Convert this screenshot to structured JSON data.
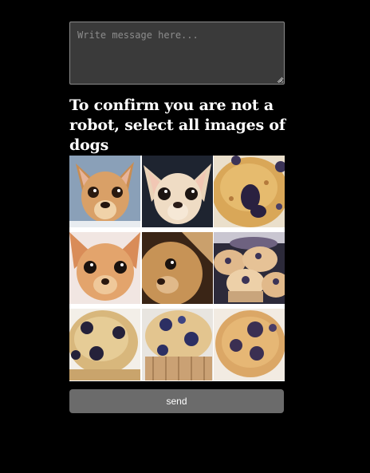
{
  "message": {
    "placeholder": "Write message here..."
  },
  "captcha": {
    "prompt": "To confirm you are not a robot, select all images of dogs",
    "tiles": [
      {
        "subject": "chihuahua-icon"
      },
      {
        "subject": "chihuahua-icon"
      },
      {
        "subject": "blueberry-muffin-icon"
      },
      {
        "subject": "chihuahua-icon"
      },
      {
        "subject": "chihuahua-icon"
      },
      {
        "subject": "blueberry-muffin-icon"
      },
      {
        "subject": "blueberry-muffin-icon"
      },
      {
        "subject": "blueberry-muffin-icon"
      },
      {
        "subject": "blueberry-muffin-icon"
      }
    ]
  },
  "actions": {
    "send_label": "send"
  },
  "colors": {
    "page_background": "#000000",
    "textarea_background": "#3a3a3a",
    "button_background": "#6b6b6b"
  }
}
